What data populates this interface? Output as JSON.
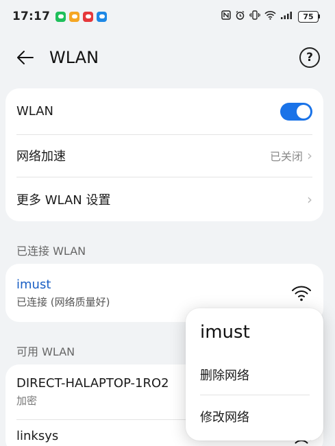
{
  "status_bar": {
    "time": "17:17",
    "battery": "75",
    "notif_colors": [
      "#1fbf5b",
      "#f5a623",
      "#e5383b",
      "#1e88e5"
    ]
  },
  "header": {
    "title": "WLAN",
    "back_icon": "arrow-left-icon",
    "help_icon": "question-circle-icon"
  },
  "settings": {
    "wlan_label": "WLAN",
    "wlan_enabled": true,
    "accelerate_label": "网络加速",
    "accelerate_value": "已关闭",
    "more_label": "更多 WLAN 设置"
  },
  "connected": {
    "section_label": "已连接 WLAN",
    "name": "imust",
    "status": "已连接 (网络质量好)"
  },
  "available": {
    "section_label": "可用 WLAN",
    "networks": [
      {
        "name": "DIRECT-HALAPTOP-1RO2",
        "sub": "加密"
      },
      {
        "name": "linksys",
        "sub": ""
      }
    ]
  },
  "popup": {
    "title": "imust",
    "items": [
      "删除网络",
      "修改网络"
    ]
  },
  "colors": {
    "accent": "#1a73e8",
    "connected_name": "#1a5fc4",
    "background": "#f1f3f5"
  }
}
